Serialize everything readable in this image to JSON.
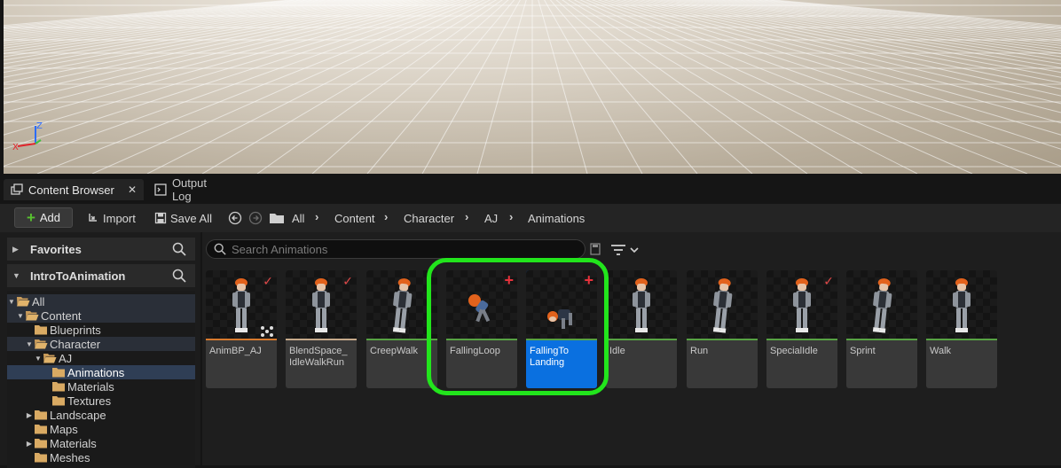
{
  "viewport": {
    "gizmo_axes": [
      "Z",
      "X",
      "Y"
    ]
  },
  "tabs": [
    {
      "label": "Content Browser",
      "active": true,
      "icon": "content-browser-icon"
    },
    {
      "label": "Output Log",
      "active": false,
      "icon": "output-log-icon"
    }
  ],
  "toolbar": {
    "add_label": "Add",
    "import_label": "Import",
    "save_all_label": "Save All",
    "breadcrumbs": [
      "All",
      "Content",
      "Character",
      "AJ",
      "Animations"
    ]
  },
  "sidebar": {
    "favorites_label": "Favorites",
    "project_label": "IntroToAnimation",
    "tree": [
      {
        "label": "All",
        "depth": 0,
        "expanded": true
      },
      {
        "label": "Content",
        "depth": 1,
        "expanded": true
      },
      {
        "label": "Blueprints",
        "depth": 2
      },
      {
        "label": "Character",
        "depth": 2,
        "expanded": true
      },
      {
        "label": "AJ",
        "depth": 3,
        "expanded": true
      },
      {
        "label": "Animations",
        "depth": 4,
        "selected": true
      },
      {
        "label": "Materials",
        "depth": 4
      },
      {
        "label": "Textures",
        "depth": 4
      },
      {
        "label": "Landscape",
        "depth": 2,
        "collapsed": true
      },
      {
        "label": "Maps",
        "depth": 2
      },
      {
        "label": "Materials",
        "depth": 2,
        "collapsed": true
      },
      {
        "label": "Meshes",
        "depth": 2
      }
    ]
  },
  "search": {
    "placeholder": "Search Animations"
  },
  "assets": [
    {
      "name": "AnimBP_AJ",
      "badge": "check",
      "bar": "orange"
    },
    {
      "name": "BlendSpace_ IdleWalkRun",
      "badge": "check",
      "bar": "tan"
    },
    {
      "name": "CreepWalk",
      "badge": "",
      "bar": "green"
    },
    {
      "name": "FallingLoop",
      "badge": "plus",
      "bar": "green"
    },
    {
      "name": "FallingTo Landing",
      "badge": "plus",
      "bar": "green",
      "selected": true
    },
    {
      "name": "Idle",
      "badge": "",
      "bar": "green"
    },
    {
      "name": "Run",
      "badge": "",
      "bar": "green"
    },
    {
      "name": "SpecialIdle",
      "badge": "check",
      "bar": "green"
    },
    {
      "name": "Sprint",
      "badge": "",
      "bar": "green"
    },
    {
      "name": "Walk",
      "badge": "",
      "bar": "green"
    }
  ],
  "colors": {
    "accent_select": "#0a70e0",
    "highlight_ring": "#22e51c",
    "anim_bar": "#57a243",
    "badge_red": "#e04848"
  }
}
